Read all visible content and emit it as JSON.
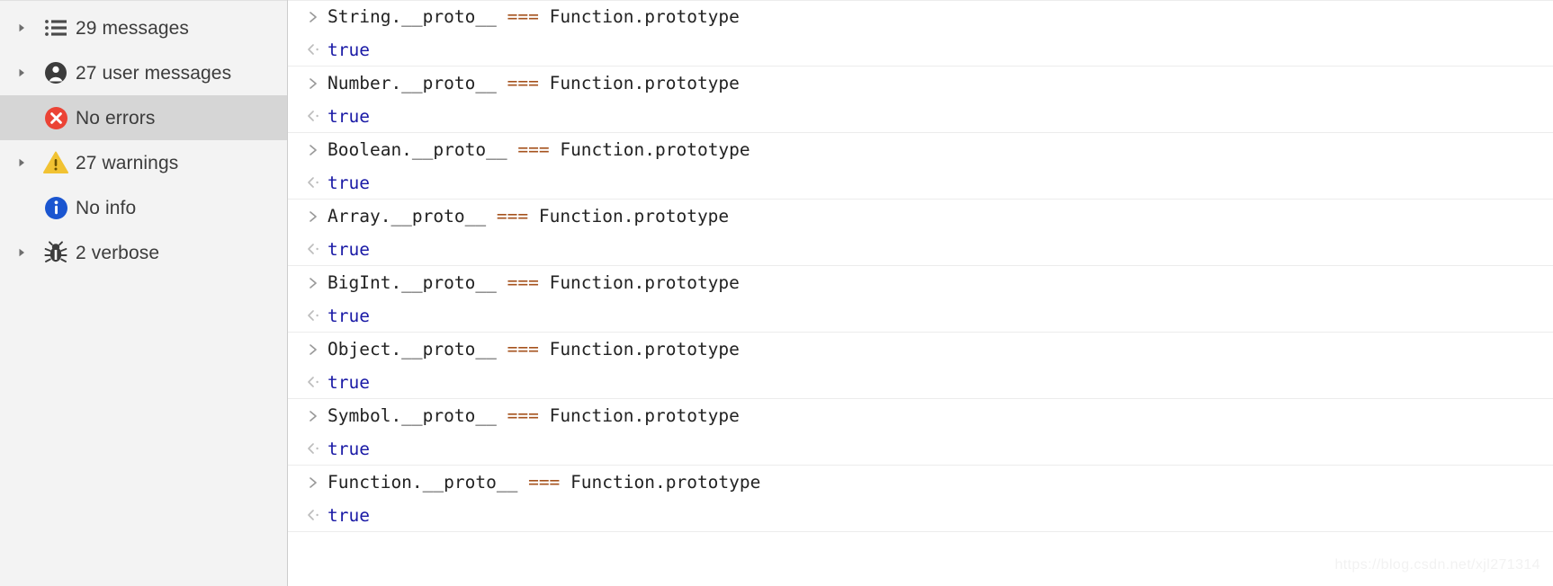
{
  "sidebar": {
    "items": [
      {
        "label": "29 messages",
        "icon": "list-icon",
        "has_twisty": true,
        "selected": false
      },
      {
        "label": "27 user messages",
        "icon": "person-icon",
        "has_twisty": true,
        "selected": false
      },
      {
        "label": "No errors",
        "icon": "error-icon",
        "has_twisty": false,
        "selected": true
      },
      {
        "label": "27 warnings",
        "icon": "warning-icon",
        "has_twisty": true,
        "selected": false
      },
      {
        "label": "No info",
        "icon": "info-icon",
        "has_twisty": false,
        "selected": false
      },
      {
        "label": "2 verbose",
        "icon": "bug-icon",
        "has_twisty": true,
        "selected": false
      }
    ]
  },
  "console": {
    "entries": [
      {
        "type": "input",
        "gutter": "input-chevron-icon",
        "left": "String.__proto__",
        "op": "===",
        "right": "Function.prototype"
      },
      {
        "type": "output",
        "gutter": "output-chevron-icon",
        "value": "true"
      },
      {
        "type": "input",
        "gutter": "input-chevron-icon",
        "left": "Number.__proto__",
        "op": "===",
        "right": "Function.prototype"
      },
      {
        "type": "output",
        "gutter": "output-chevron-icon",
        "value": "true"
      },
      {
        "type": "input",
        "gutter": "input-chevron-icon",
        "left": "Boolean.__proto__",
        "op": "===",
        "right": "Function.prototype"
      },
      {
        "type": "output",
        "gutter": "output-chevron-icon",
        "value": "true"
      },
      {
        "type": "input",
        "gutter": "input-chevron-icon",
        "left": "Array.__proto__",
        "op": "===",
        "right": "Function.prototype"
      },
      {
        "type": "output",
        "gutter": "output-chevron-icon",
        "value": "true"
      },
      {
        "type": "input",
        "gutter": "input-chevron-icon",
        "left": "BigInt.__proto__",
        "op": "===",
        "right": "Function.prototype"
      },
      {
        "type": "output",
        "gutter": "output-chevron-icon",
        "value": "true"
      },
      {
        "type": "input",
        "gutter": "input-chevron-icon",
        "left": "Object.__proto__",
        "op": "===",
        "right": "Function.prototype"
      },
      {
        "type": "output",
        "gutter": "output-chevron-icon",
        "value": "true"
      },
      {
        "type": "input",
        "gutter": "input-chevron-icon",
        "left": "Symbol.__proto__",
        "op": "===",
        "right": "Function.prototype"
      },
      {
        "type": "output",
        "gutter": "output-chevron-icon",
        "value": "true"
      },
      {
        "type": "input",
        "gutter": "input-chevron-icon",
        "left": "Function.__proto__",
        "op": "===",
        "right": "Function.prototype"
      },
      {
        "type": "output",
        "gutter": "output-chevron-icon",
        "value": "true"
      }
    ]
  },
  "watermark": {
    "text": "https://blog.csdn.net/xjl271314"
  },
  "colors": {
    "sidebar_bg": "#f3f3f3",
    "selected_bg": "#d6d6d6",
    "operator": "#a5521d",
    "boolean": "#1a1aa6",
    "error": "#eb4335",
    "warning": "#f1c232",
    "info": "#1a55d0",
    "text": "#3c3c3c"
  }
}
